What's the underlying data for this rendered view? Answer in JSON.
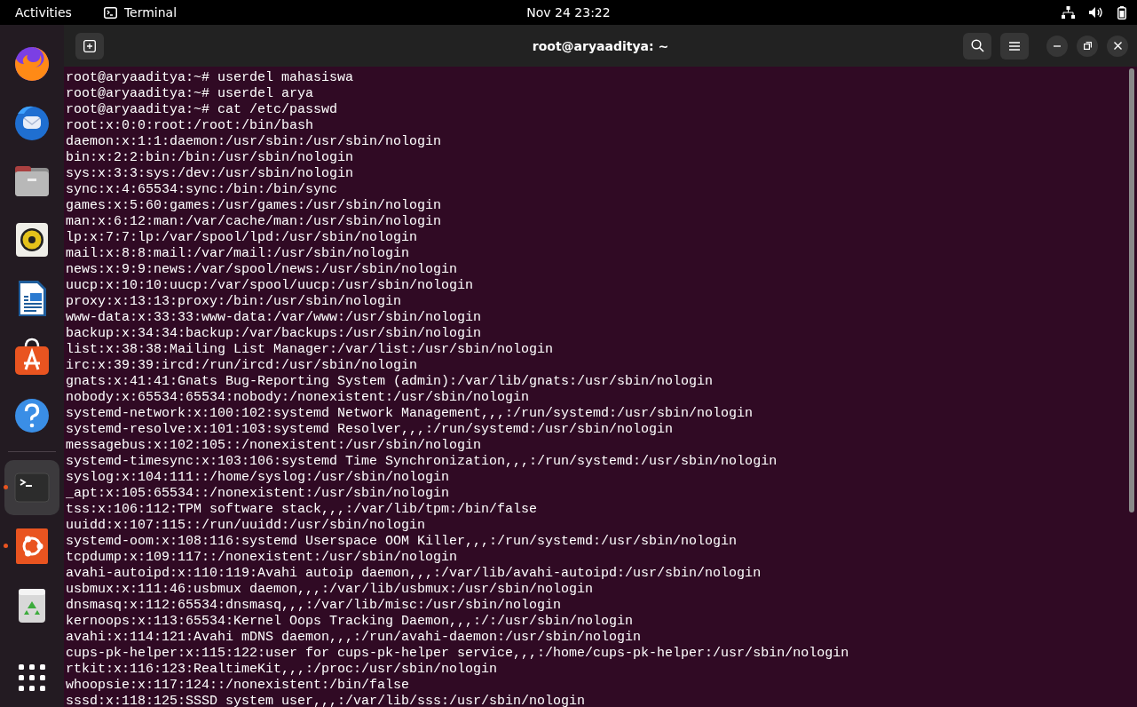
{
  "top_bar": {
    "activities": "Activities",
    "app_name": "Terminal",
    "clock": "Nov 24  23:22"
  },
  "dock": {
    "items": [
      {
        "kind": "firefox",
        "running": false,
        "selected": false
      },
      {
        "kind": "thunderbird",
        "running": false,
        "selected": false
      },
      {
        "kind": "files",
        "running": false,
        "selected": false
      },
      {
        "kind": "rhythmbox",
        "running": false,
        "selected": false
      },
      {
        "kind": "writer",
        "running": false,
        "selected": false
      },
      {
        "kind": "software",
        "running": false,
        "selected": false
      },
      {
        "kind": "help",
        "running": false,
        "selected": false
      },
      {
        "kind": "terminal",
        "running": true,
        "selected": true
      },
      {
        "kind": "ubuntu",
        "running": true,
        "selected": false
      },
      {
        "kind": "trash",
        "running": false,
        "selected": false
      }
    ]
  },
  "window": {
    "title": "root@aryaaditya: ~",
    "lines": [
      "root@aryaaditya:~# userdel mahasiswa",
      "root@aryaaditya:~# userdel arya",
      "root@aryaaditya:~# cat /etc/passwd",
      "root:x:0:0:root:/root:/bin/bash",
      "daemon:x:1:1:daemon:/usr/sbin:/usr/sbin/nologin",
      "bin:x:2:2:bin:/bin:/usr/sbin/nologin",
      "sys:x:3:3:sys:/dev:/usr/sbin/nologin",
      "sync:x:4:65534:sync:/bin:/bin/sync",
      "games:x:5:60:games:/usr/games:/usr/sbin/nologin",
      "man:x:6:12:man:/var/cache/man:/usr/sbin/nologin",
      "lp:x:7:7:lp:/var/spool/lpd:/usr/sbin/nologin",
      "mail:x:8:8:mail:/var/mail:/usr/sbin/nologin",
      "news:x:9:9:news:/var/spool/news:/usr/sbin/nologin",
      "uucp:x:10:10:uucp:/var/spool/uucp:/usr/sbin/nologin",
      "proxy:x:13:13:proxy:/bin:/usr/sbin/nologin",
      "www-data:x:33:33:www-data:/var/www:/usr/sbin/nologin",
      "backup:x:34:34:backup:/var/backups:/usr/sbin/nologin",
      "list:x:38:38:Mailing List Manager:/var/list:/usr/sbin/nologin",
      "irc:x:39:39:ircd:/run/ircd:/usr/sbin/nologin",
      "gnats:x:41:41:Gnats Bug-Reporting System (admin):/var/lib/gnats:/usr/sbin/nologin",
      "nobody:x:65534:65534:nobody:/nonexistent:/usr/sbin/nologin",
      "systemd-network:x:100:102:systemd Network Management,,,:/run/systemd:/usr/sbin/nologin",
      "systemd-resolve:x:101:103:systemd Resolver,,,:/run/systemd:/usr/sbin/nologin",
      "messagebus:x:102:105::/nonexistent:/usr/sbin/nologin",
      "systemd-timesync:x:103:106:systemd Time Synchronization,,,:/run/systemd:/usr/sbin/nologin",
      "syslog:x:104:111::/home/syslog:/usr/sbin/nologin",
      "_apt:x:105:65534::/nonexistent:/usr/sbin/nologin",
      "tss:x:106:112:TPM software stack,,,:/var/lib/tpm:/bin/false",
      "uuidd:x:107:115::/run/uuidd:/usr/sbin/nologin",
      "systemd-oom:x:108:116:systemd Userspace OOM Killer,,,:/run/systemd:/usr/sbin/nologin",
      "tcpdump:x:109:117::/nonexistent:/usr/sbin/nologin",
      "avahi-autoipd:x:110:119:Avahi autoip daemon,,,:/var/lib/avahi-autoipd:/usr/sbin/nologin",
      "usbmux:x:111:46:usbmux daemon,,,:/var/lib/usbmux:/usr/sbin/nologin",
      "dnsmasq:x:112:65534:dnsmasq,,,:/var/lib/misc:/usr/sbin/nologin",
      "kernoops:x:113:65534:Kernel Oops Tracking Daemon,,,:/:/usr/sbin/nologin",
      "avahi:x:114:121:Avahi mDNS daemon,,,:/run/avahi-daemon:/usr/sbin/nologin",
      "cups-pk-helper:x:115:122:user for cups-pk-helper service,,,:/home/cups-pk-helper:/usr/sbin/nologin",
      "rtkit:x:116:123:RealtimeKit,,,:/proc:/usr/sbin/nologin",
      "whoopsie:x:117:124::/nonexistent:/bin/false",
      "sssd:x:118:125:SSSD system user,,,:/var/lib/sss:/usr/sbin/nologin"
    ]
  }
}
